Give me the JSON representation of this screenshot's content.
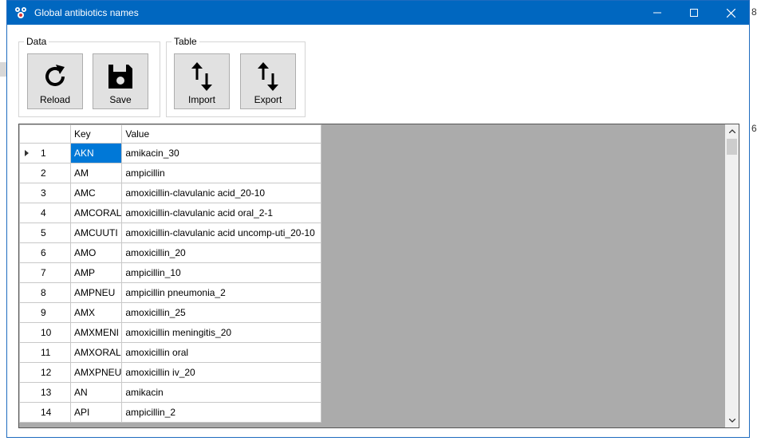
{
  "window": {
    "title": "Global antibiotics names"
  },
  "desktop": {
    "right_char_1": "8",
    "right_char_2": "6"
  },
  "groups": {
    "data_label": "Data",
    "table_label": "Table"
  },
  "toolbar": {
    "reload_label": "Reload",
    "save_label": "Save",
    "import_label": "Import",
    "export_label": "Export"
  },
  "grid": {
    "columns": [
      "Key",
      "Value"
    ],
    "rows": [
      {
        "n": "1",
        "key": "AKN",
        "value": "amikacin_30"
      },
      {
        "n": "2",
        "key": "AM",
        "value": "ampicillin"
      },
      {
        "n": "3",
        "key": "AMC",
        "value": "amoxicillin-clavulanic acid_20-10"
      },
      {
        "n": "4",
        "key": "AMCORAL",
        "value": "amoxicillin-clavulanic acid oral_2-1"
      },
      {
        "n": "5",
        "key": "AMCUUTI",
        "value": "amoxicillin-clavulanic acid uncomp-uti_20-10"
      },
      {
        "n": "6",
        "key": "AMO",
        "value": "amoxicillin_20"
      },
      {
        "n": "7",
        "key": "AMP",
        "value": "ampicillin_10"
      },
      {
        "n": "8",
        "key": "AMPNEU",
        "value": "ampicillin pneumonia_2"
      },
      {
        "n": "9",
        "key": "AMX",
        "value": "amoxicillin_25"
      },
      {
        "n": "10",
        "key": "AMXMENI",
        "value": "amoxicillin meningitis_20"
      },
      {
        "n": "11",
        "key": "AMXORAL",
        "value": "amoxicillin oral"
      },
      {
        "n": "12",
        "key": "AMXPNEU",
        "value": "amoxicillin iv_20"
      },
      {
        "n": "13",
        "key": "AN",
        "value": "amikacin"
      },
      {
        "n": "14",
        "key": "API",
        "value": "ampicillin_2"
      }
    ]
  },
  "icons": {
    "app": "app-icon",
    "reload": "refresh-icon",
    "save": "floppy-disk-icon",
    "import": "up-down-arrows-icon",
    "export": "up-down-arrows-icon"
  },
  "colors": {
    "titlebar": "#0067c0",
    "selection": "#0078d7",
    "grid_background": "#ababab"
  }
}
